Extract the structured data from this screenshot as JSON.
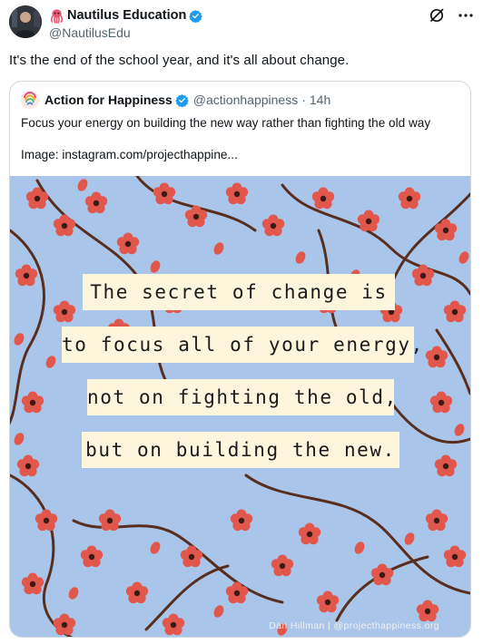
{
  "post": {
    "display_name": "Nautilus Education",
    "handle": "@NautilusEdu",
    "text": "It's the end of the school year, and it's all about change."
  },
  "quote": {
    "display_name": "Action for Happiness",
    "handle": "@actionhappiness",
    "separator": "·",
    "time": "14h",
    "text": "Focus your energy on building the new way rather than fighting the old way",
    "image_link_text": "Image: instagram.com/projecthappine...",
    "image": {
      "lines": [
        "The secret of change is",
        "to focus all of your energy,",
        "not on fighting the old,",
        "but on building the new."
      ],
      "credit": "Dan Hillman | @projecthappiness.org"
    }
  },
  "colors": {
    "verified_blue": "#1d9bf0",
    "image_background": "#a9c6ea",
    "blossom": "#e2574c",
    "branch": "#5a2e1e",
    "quote_band": "#fdf6dc"
  }
}
